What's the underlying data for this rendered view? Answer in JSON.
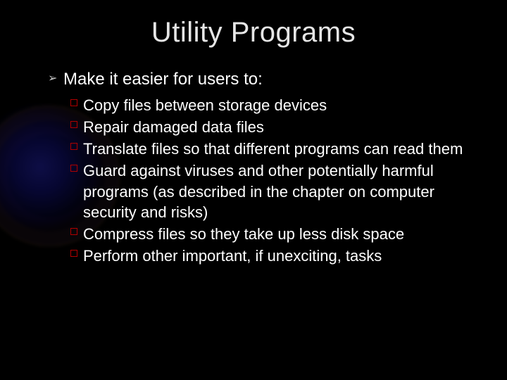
{
  "title": "Utility Programs",
  "level1": {
    "text": "Make it easier for users to:"
  },
  "level2": [
    {
      "text": "Copy files between storage devices"
    },
    {
      "text": "Repair damaged data files"
    },
    {
      "text": "Translate files so that different programs can read them"
    },
    {
      "text": "Guard against viruses and other potentially harmful programs (as described in the chapter on computer security and risks)"
    },
    {
      "text": "Compress files so they take up less disk space"
    },
    {
      "text": "Perform other important, if unexciting, tasks"
    }
  ]
}
